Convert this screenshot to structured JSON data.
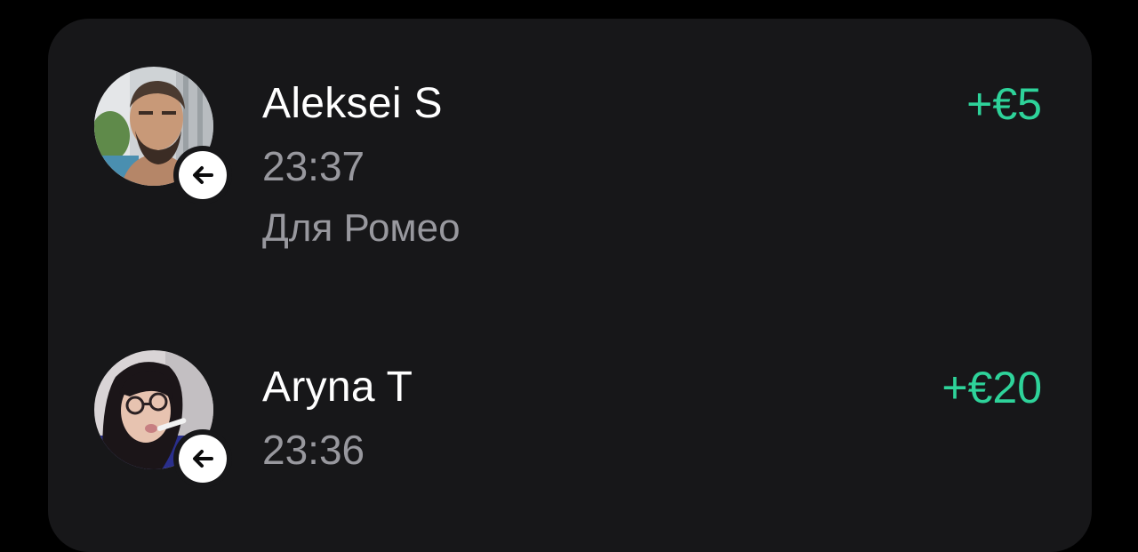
{
  "colors": {
    "background": "#000000",
    "card": "#171719",
    "primary_text": "#ffffff",
    "secondary_text": "#98989e",
    "amount_positive": "#2ed39a"
  },
  "transactions": [
    {
      "name": "Aleksei S",
      "time": "23:37",
      "note": "Для Ромео",
      "amount": "+€5",
      "direction_icon": "arrow-left-icon",
      "avatar": "user-avatar-photo"
    },
    {
      "name": "Aryna T",
      "time": "23:36",
      "amount": "+€20",
      "direction_icon": "arrow-left-icon",
      "avatar": "user-avatar-photo"
    }
  ]
}
